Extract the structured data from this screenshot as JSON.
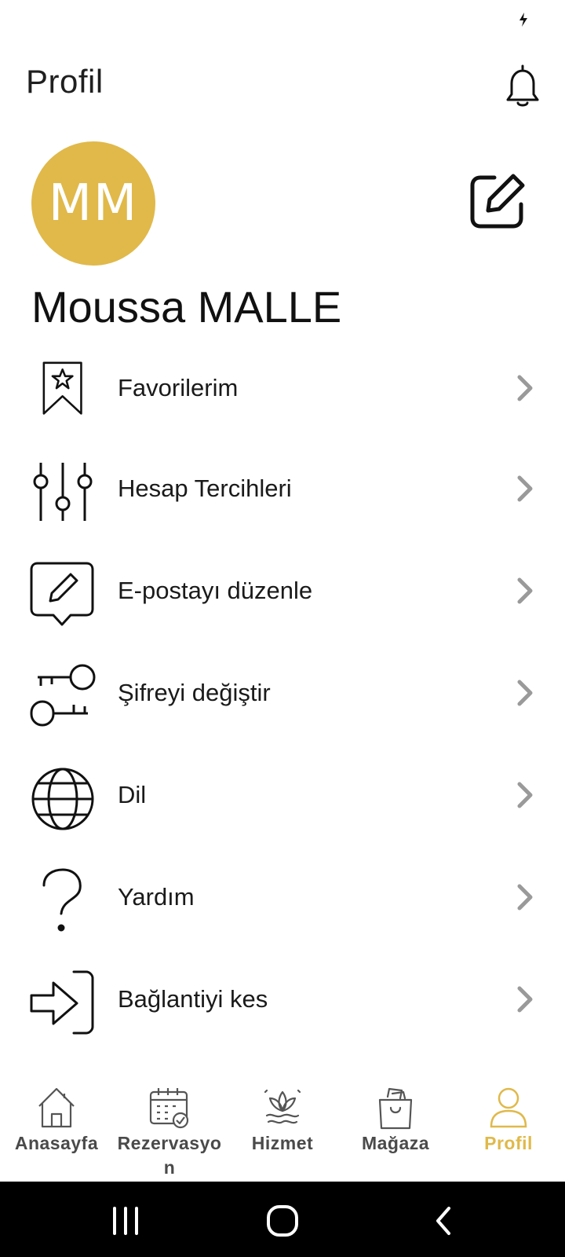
{
  "header": {
    "title": "Profil"
  },
  "profile": {
    "initials": "MM",
    "name": "Moussa MALLE",
    "avatar_color": "#e0b94a"
  },
  "menu": {
    "items": [
      {
        "label": "Favorilerim",
        "icon": "bookmark-star-icon"
      },
      {
        "label": "Hesap Tercihleri",
        "icon": "sliders-icon"
      },
      {
        "label": "E-postayı düzenle",
        "icon": "edit-message-icon"
      },
      {
        "label": "Şifreyi değiştir",
        "icon": "key-icon"
      },
      {
        "label": "Dil",
        "icon": "globe-icon"
      },
      {
        "label": "Yardım",
        "icon": "question-icon"
      },
      {
        "label": "Bağlantiyi kes",
        "icon": "logout-icon"
      }
    ]
  },
  "bottom_nav": {
    "items": [
      {
        "label": "Anasayfa",
        "icon": "home-icon",
        "active": false
      },
      {
        "label": "Rezervasyon",
        "icon": "calendar-check-icon",
        "active": false
      },
      {
        "label": "Hizmet",
        "icon": "lotus-icon",
        "active": false
      },
      {
        "label": "Mağaza",
        "icon": "shopping-bag-icon",
        "active": false
      },
      {
        "label": "Profil",
        "icon": "user-icon",
        "active": true
      }
    ],
    "active_color": "#e0b94a",
    "inactive_color": "#4a4a4a"
  },
  "system_nav": {
    "buttons": [
      "recents-icon",
      "home-circle-icon",
      "back-icon"
    ]
  }
}
